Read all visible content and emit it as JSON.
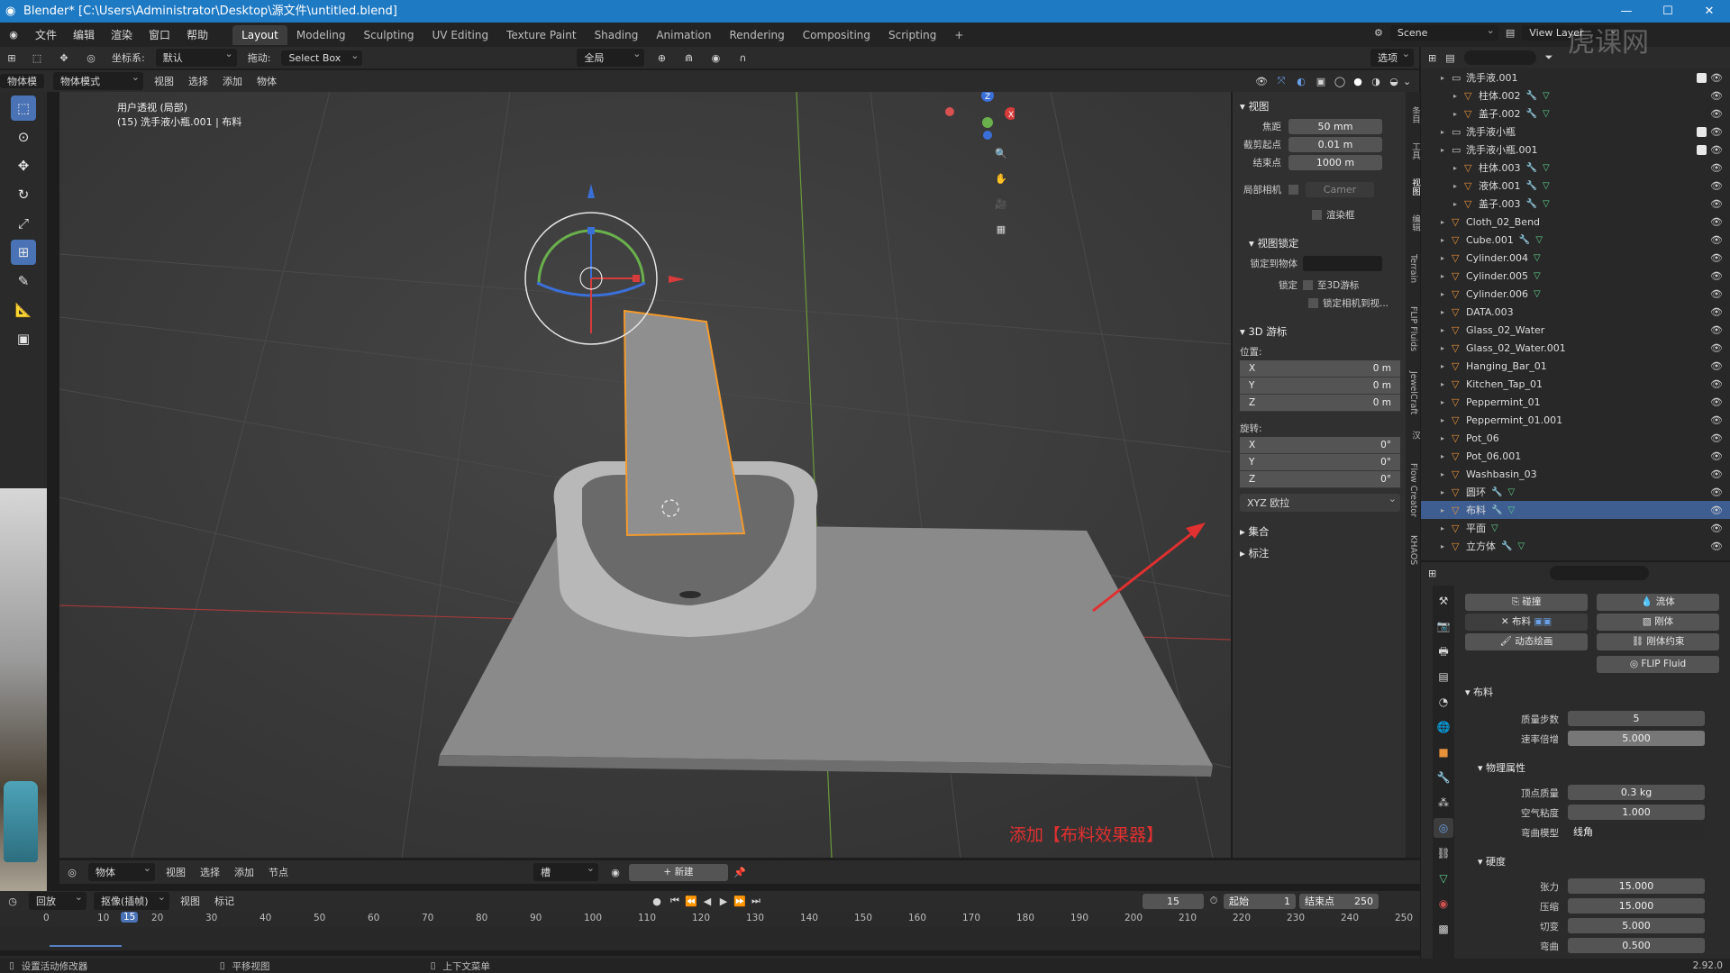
{
  "window": {
    "title": "Blender* [C:\\Users\\Administrator\\Desktop\\源文件\\untitled.blend]",
    "logo_icon": "blender-logo-icon",
    "controls": [
      "minimize-icon",
      "maximize-icon",
      "close-icon"
    ]
  },
  "menu": {
    "items": [
      "文件",
      "编辑",
      "渲染",
      "窗口",
      "帮助"
    ],
    "workspaces": [
      "Layout",
      "Modeling",
      "Sculpting",
      "UV Editing",
      "Texture Paint",
      "Shading",
      "Animation",
      "Rendering",
      "Compositing",
      "Scripting"
    ],
    "active_workspace": "Layout",
    "add_tab": "+",
    "scene": "Scene",
    "view_layer": "View Layer"
  },
  "tool_header": {
    "coord_label": "坐标系:",
    "coord_value": "默认",
    "drag_label": "拖动:",
    "drag_value": "Select Box",
    "pivot_value": "全局",
    "options": "选项"
  },
  "viewport_header": {
    "mode_left": "物体模",
    "mode": "物体模式",
    "menus": [
      "视图",
      "选择",
      "添加",
      "物体"
    ]
  },
  "viewport": {
    "view_name": "用户透视 (局部)",
    "object_info": "(15) 洗手液小瓶.001 | 布料",
    "annotation": "添加【布料效果器】",
    "accent_color": "#e03030"
  },
  "npanel": {
    "view_section": "视图",
    "focal_label": "焦距",
    "focal_value": "50 mm",
    "clip_start_label": "截剪起点",
    "clip_start_value": "0.01 m",
    "clip_end_label": "结束点",
    "clip_end_value": "1000 m",
    "local_cam_label": "局部相机",
    "local_cam_value": "Camer",
    "render_region": "渲染框",
    "view_lock": "视图锁定",
    "lock_to_obj": "锁定到物体",
    "lock_label": "锁定",
    "lock_3d_cursor": "至3D游标",
    "lock_cam_view": "锁定相机到视...",
    "cursor_section": "3D 游标",
    "location_label": "位置:",
    "location": [
      {
        "axis": "X",
        "value": "0 m"
      },
      {
        "axis": "Y",
        "value": "0 m"
      },
      {
        "axis": "Z",
        "value": "0 m"
      }
    ],
    "rotation_label": "旋转:",
    "rotation": [
      {
        "axis": "X",
        "value": "0°"
      },
      {
        "axis": "Y",
        "value": "0°"
      },
      {
        "axis": "Z",
        "value": "0°"
      }
    ],
    "rotation_mode": "XYZ 欧拉",
    "collections": "集合",
    "annotations": "标注",
    "tabs": [
      "条目",
      "工具",
      "视图",
      "编辑",
      "Terrain",
      "FLIP Fluids",
      "JewelCraft",
      "汉",
      "Flow Creator",
      "KHAOS"
    ]
  },
  "outliner": {
    "rows": [
      {
        "name": "洗手液.001",
        "type": "coll",
        "indent": 1,
        "chk": true
      },
      {
        "name": "柱体.002",
        "type": "obj",
        "indent": 2,
        "mod": true,
        "mesh": true
      },
      {
        "name": "盖子.002",
        "type": "obj",
        "indent": 2,
        "mod": true,
        "mesh": true
      },
      {
        "name": "洗手液小瓶",
        "type": "coll",
        "indent": 1,
        "chk": true
      },
      {
        "name": "洗手液小瓶.001",
        "type": "coll",
        "indent": 1,
        "chk": true
      },
      {
        "name": "柱体.003",
        "type": "obj",
        "indent": 2,
        "mod": true,
        "mesh": true
      },
      {
        "name": "液体.001",
        "type": "obj",
        "indent": 2,
        "mod": true,
        "mesh": true
      },
      {
        "name": "盖子.003",
        "type": "obj",
        "indent": 2,
        "mod": true,
        "mesh": true
      },
      {
        "name": "Cloth_02_Bend",
        "type": "obj",
        "indent": 1
      },
      {
        "name": "Cube.001",
        "type": "obj",
        "indent": 1,
        "mod": true,
        "mesh": true
      },
      {
        "name": "Cylinder.004",
        "type": "obj",
        "indent": 1,
        "mesh": true
      },
      {
        "name": "Cylinder.005",
        "type": "obj",
        "indent": 1,
        "mesh": true
      },
      {
        "name": "Cylinder.006",
        "type": "obj",
        "indent": 1,
        "mesh": true
      },
      {
        "name": "DATA.003",
        "type": "obj",
        "indent": 1
      },
      {
        "name": "Glass_02_Water",
        "type": "obj",
        "indent": 1
      },
      {
        "name": "Glass_02_Water.001",
        "type": "obj",
        "indent": 1
      },
      {
        "name": "Hanging_Bar_01",
        "type": "obj",
        "indent": 1
      },
      {
        "name": "Kitchen_Tap_01",
        "type": "obj",
        "indent": 1
      },
      {
        "name": "Peppermint_01",
        "type": "obj",
        "indent": 1
      },
      {
        "name": "Peppermint_01.001",
        "type": "obj",
        "indent": 1
      },
      {
        "name": "Pot_06",
        "type": "obj",
        "indent": 1
      },
      {
        "name": "Pot_06.001",
        "type": "obj",
        "indent": 1
      },
      {
        "name": "Washbasin_03",
        "type": "obj",
        "indent": 1
      },
      {
        "name": "圆环",
        "type": "obj",
        "indent": 1,
        "mod": true,
        "mesh": true
      },
      {
        "name": "布料",
        "type": "obj",
        "indent": 1,
        "mod": true,
        "mesh": true,
        "sel": true
      },
      {
        "name": "平面",
        "type": "obj",
        "indent": 1,
        "mesh": true
      },
      {
        "name": "立方体",
        "type": "obj",
        "indent": 1,
        "mod": true,
        "mesh": true
      }
    ]
  },
  "physics": {
    "buttons": {
      "collision": "碰撞",
      "fluid": "流体",
      "cloth": "布料",
      "rigid_body": "刚体",
      "dynamic_paint": "动态绘画",
      "rigid_constraint": "刚体约束",
      "flip_fluid": "FLIP Fluid"
    },
    "cloth_section": "布料",
    "quality_label": "质量步数",
    "quality_value": "5",
    "speed_label": "速率倍增",
    "speed_value": "5.000",
    "phys_section": "物理属性",
    "mass_label": "顶点质量",
    "mass_value": "0.3 kg",
    "air_label": "空气粘度",
    "air_value": "1.000",
    "bend_model_label": "弯曲模型",
    "bend_model_value": "线角",
    "stiff_section": "硬度",
    "tension_label": "张力",
    "tension_value": "15.000",
    "compress_label": "压缩",
    "compress_value": "15.000",
    "shear_label": "切变",
    "shear_value": "5.000",
    "bending_label": "弯曲",
    "bending_value": "0.500"
  },
  "bottom_header": {
    "mode": "物体",
    "menus": [
      "视图",
      "选择",
      "添加",
      "节点"
    ],
    "slot": "槽",
    "new": "新建"
  },
  "timeline": {
    "playback": "回放",
    "keying": "抠像(插帧)",
    "view": "视图",
    "marker": "标记",
    "current_frame": "15",
    "start_label": "起始",
    "start": "1",
    "end_label": "结束点",
    "end": "250",
    "ticks": [
      "0",
      "10",
      "20",
      "30",
      "40",
      "50",
      "60",
      "70",
      "80",
      "90",
      "100",
      "110",
      "120",
      "130",
      "140",
      "150",
      "160",
      "170",
      "180",
      "190",
      "200",
      "210",
      "220",
      "230",
      "240",
      "250"
    ]
  },
  "status": {
    "left": "设置活动修改器",
    "middle": "平移视图",
    "right": "上下文菜单",
    "version": "2.92.0"
  },
  "watermark": "虎课网"
}
